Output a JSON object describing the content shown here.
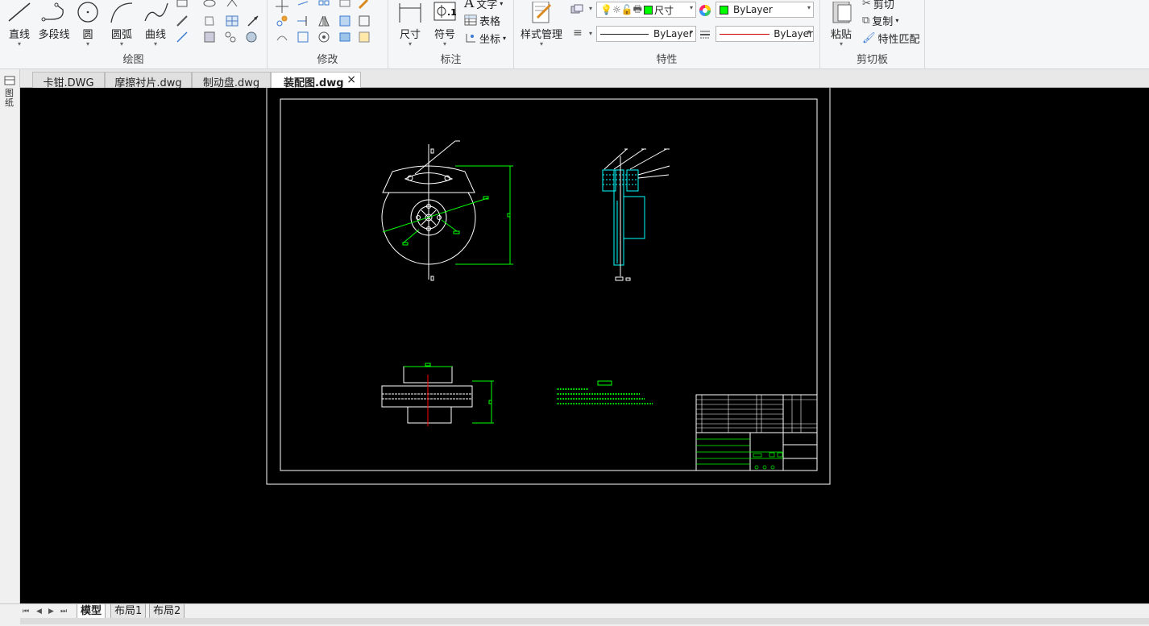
{
  "ribbon": {
    "draw": {
      "title": "绘图",
      "line": "直线",
      "polyline": "多段线",
      "circle": "圆",
      "arc": "圆弧",
      "curve": "曲线"
    },
    "modify": {
      "title": "修改"
    },
    "annotate": {
      "title": "标注",
      "dimension": "尺寸",
      "symbol": "符号",
      "text": "文字",
      "table": "表格",
      "coordinate": "坐标"
    },
    "properties": {
      "title": "特性",
      "style_manager": "样式管理",
      "layer_name": "尺寸",
      "color_value": "ByLayer",
      "linetype_value": "ByLayer",
      "lineweight_value": "ByLayer",
      "layer_color": "#00ff00"
    },
    "clipboard": {
      "title": "剪切板",
      "paste": "粘贴",
      "cut": "剪切",
      "copy": "复制",
      "match_properties": "特性匹配"
    }
  },
  "doc_tabs": [
    "卡钳.DWG",
    "摩擦衬片.dwg",
    "制动盘.dwg",
    "装配图.dwg"
  ],
  "active_tab": "装配图.dwg",
  "close_glyph": "×",
  "left_panel_label": "图纸",
  "layout_tabs": [
    "模型",
    "布局1",
    "布局2"
  ],
  "active_layout": "模型",
  "colors": {
    "canvas_bg": "#000000",
    "drawing_line": "#ffffff",
    "dimension": "#00ff00",
    "section_hatch": "#00ffff",
    "center_line": "#ff0000"
  }
}
